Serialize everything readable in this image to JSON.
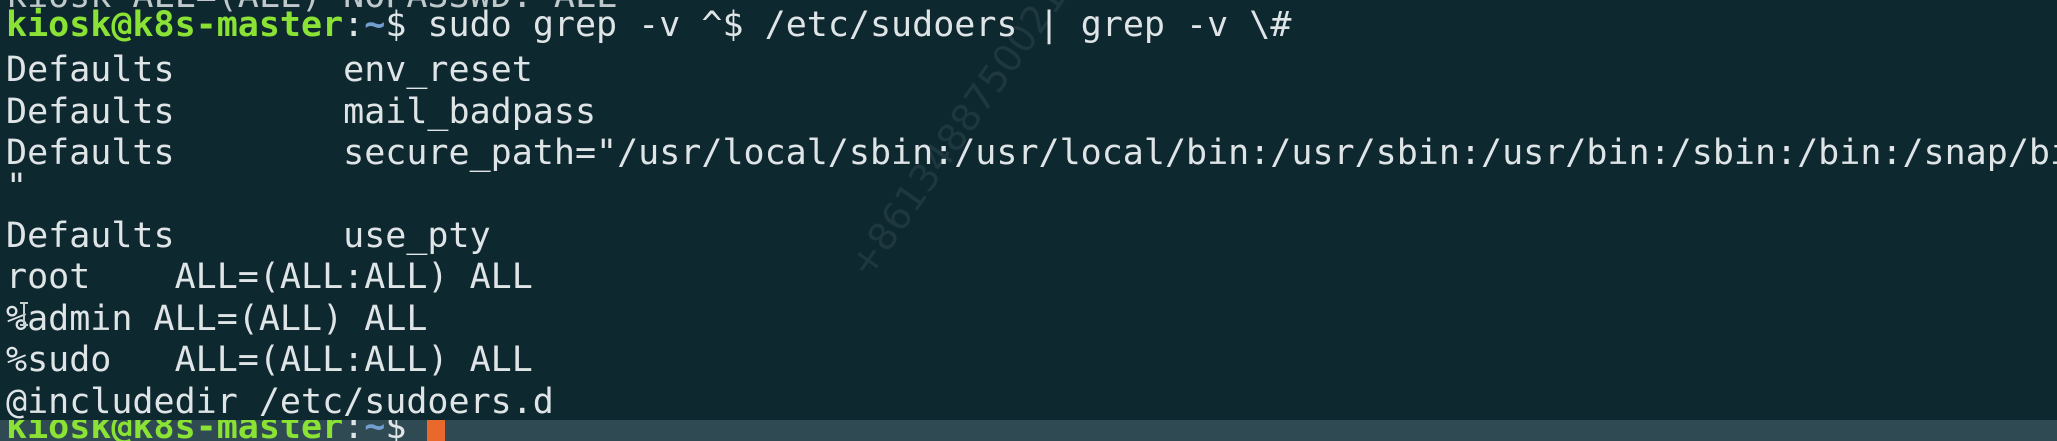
{
  "terminal": {
    "cut_line": "kiosk ALL=(ALL) NOPASSWD: ALL",
    "prompt": {
      "user": "kiosk@k8s-master",
      "sep": ":",
      "path": "~",
      "symbol": "$ "
    },
    "command": "sudo grep -v ^$ /etc/sudoers | grep -v \\#",
    "output": [
      "Defaults        env_reset",
      "Defaults        mail_badpass",
      "Defaults        secure_path=\"/usr/local/sbin:/usr/local/bin:/usr/sbin:/usr/bin:/sbin:/bin:/snap/bin",
      "\"",
      "Defaults        use_pty",
      "root    ALL=(ALL:ALL) ALL",
      "%admin ALL=(ALL) ALL",
      "%sudo   ALL=(ALL:ALL) ALL",
      "@includedir /etc/sudoers.d"
    ],
    "cursor_color": "#e9692c",
    "prompt_color": "#8ae234",
    "path_color": "#729fcf",
    "background": "#0e2830"
  },
  "watermark": "+8613488750021"
}
